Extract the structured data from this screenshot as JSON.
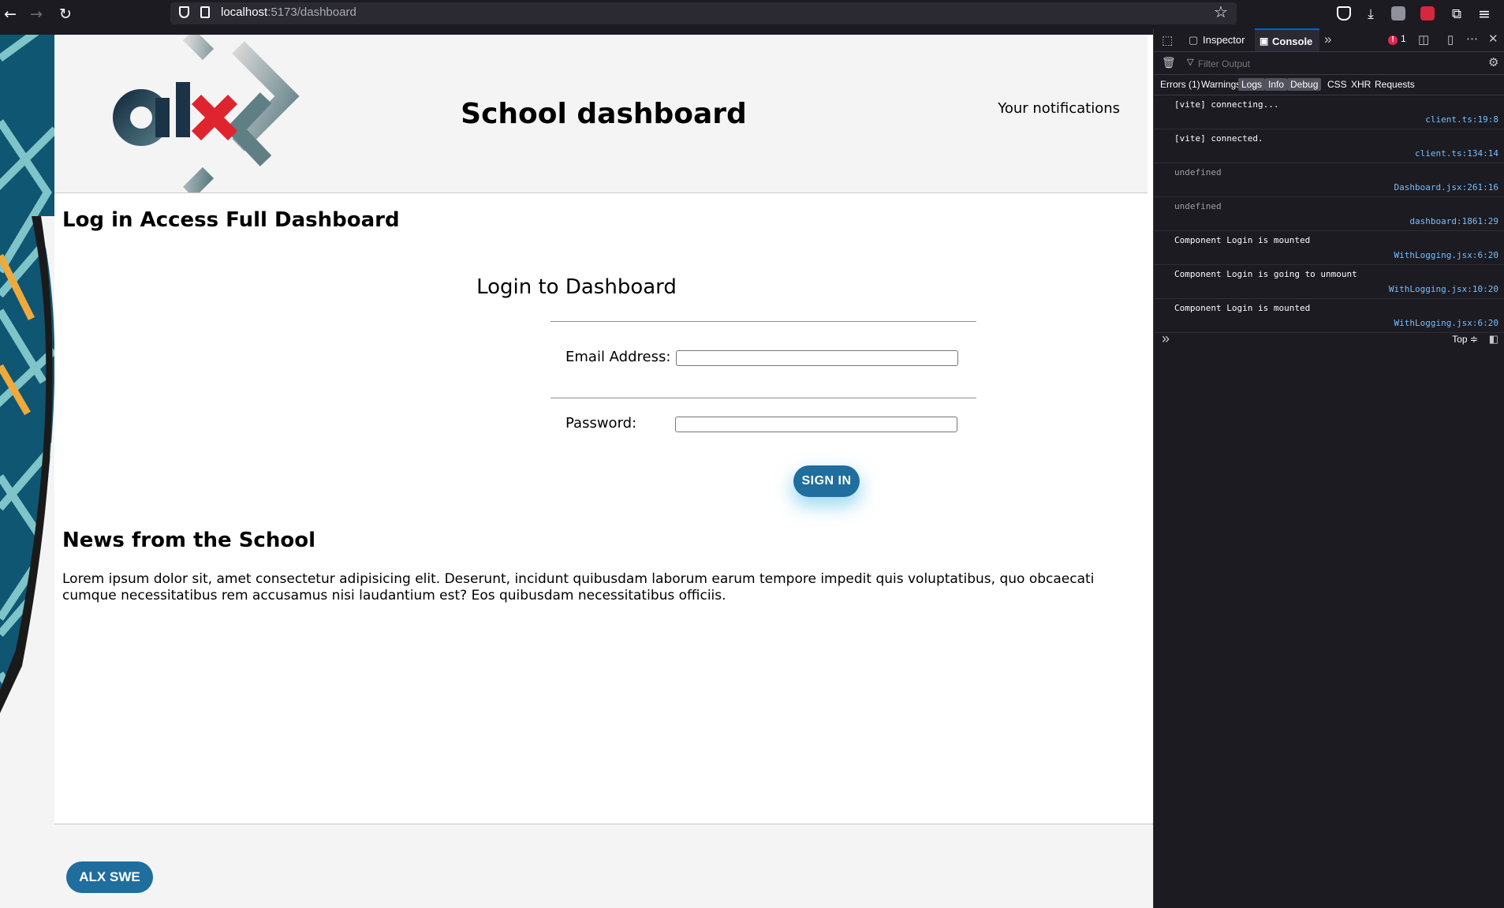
{
  "browser": {
    "url_host": "localhost",
    "url_path": ":5173/dashboard"
  },
  "header": {
    "title": "School dashboard",
    "notifications": "Your notifications"
  },
  "login_section": {
    "heading": "Log in Access Full Dashboard",
    "form_title": "Login to Dashboard",
    "email_label": "Email Address:",
    "email_value": "",
    "password_label": "Password:",
    "password_value": "",
    "signin_label": "SIGN IN"
  },
  "news": {
    "heading": "News from the School",
    "body": "Lorem ipsum dolor sit, amet consectetur adipisicing elit. Deserunt, incidunt quibusdam laborum earum tempore impedit quis voluptatibus, quo obcaecati cumque necessitatibus rem accusamus nisi laudantium est? Eos quibusdam necessitatibus officiis."
  },
  "footer": {
    "badge": "ALX SWE"
  },
  "devtools": {
    "tabs": [
      "Inspector",
      "Console"
    ],
    "active_tab": "Console",
    "error_count": "1",
    "filter_placeholder": "Filter Output",
    "categories": [
      "Errors (1)",
      "Warnings",
      "Logs",
      "Info",
      "Debug",
      "CSS",
      "XHR",
      "Requests"
    ],
    "context": "Top ≑",
    "logs": [
      {
        "message": "[vite] connecting...",
        "source": "client.ts:19:8"
      },
      {
        "message": "[vite] connected.",
        "source": "client.ts:134:14"
      },
      {
        "message": "undefined",
        "source": "Dashboard.jsx:261:16"
      },
      {
        "message": "undefined",
        "source": "dashboard:1861:29"
      },
      {
        "message": "Component Login is mounted",
        "source": "WithLogging.jsx:6:20"
      },
      {
        "message": "Component Login is going to unmount",
        "source": "WithLogging.jsx:10:20"
      },
      {
        "message": "Component Login is mounted",
        "source": "WithLogging.jsx:6:20"
      }
    ]
  },
  "colors": {
    "brand_blue": "#1f6e9d",
    "logo_red": "#e0242f",
    "logo_dark": "#1b3346",
    "devtools_link": "#75bfff"
  }
}
